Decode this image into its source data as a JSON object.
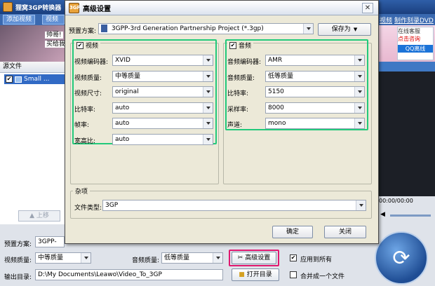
{
  "main": {
    "title": "狸窝3GP转换器",
    "menu": {
      "add_video": "添加视频",
      "video_edit": "视频编",
      "link_video": "视频",
      "link_dvd": "制作刻录DVD"
    },
    "banner": {
      "text1": "帅哥!",
      "text2": "买给我"
    },
    "ads": {
      "line1": "在线客服",
      "line2": "点击咨询",
      "line3": "QQ离线"
    },
    "file_list_header": "源文件",
    "file_item": "Small ...",
    "up_button": "上移",
    "time_display": "00:00/00:00",
    "bottom": {
      "preset_label": "预置方案:",
      "preset_value": "3GPP-",
      "video_quality_label": "视频质量:",
      "video_quality_value": "中等质量",
      "audio_quality_label": "音频质量:",
      "audio_quality_value": "低等质量",
      "advanced_button": "高级设置",
      "apply_all": "应用到所有",
      "apply_all_checked": true,
      "output_label": "输出目录:",
      "output_path": "D:\\My Documents\\Leawo\\Video_To_3GP",
      "open_dir_button": "打开目录",
      "merge_label": "合并成一个文件",
      "merge_checked": false
    }
  },
  "dialog": {
    "title": "高级设置",
    "icon_text": "3GP",
    "preset_label": "预置方案:",
    "preset_value": "3GPP-3rd Generation Partnership Project (*.3gp)",
    "save_as": "保存为",
    "video": {
      "legend": "视频",
      "enabled": true,
      "rows": [
        {
          "label": "视频编码器:",
          "value": "XVID"
        },
        {
          "label": "视频质量:",
          "value": "中等质量"
        },
        {
          "label": "视频尺寸:",
          "value": "original"
        },
        {
          "label": "比特率:",
          "value": "auto"
        },
        {
          "label": "帧率:",
          "value": "auto"
        },
        {
          "label": "宽高比:",
          "value": "auto"
        }
      ]
    },
    "audio": {
      "legend": "音频",
      "enabled": true,
      "rows": [
        {
          "label": "音频编码器:",
          "value": "AMR"
        },
        {
          "label": "音频质量:",
          "value": "低等质量"
        },
        {
          "label": "比特率:",
          "value": "5150"
        },
        {
          "label": "采样率:",
          "value": "8000"
        },
        {
          "label": "声道:",
          "value": "mono"
        }
      ]
    },
    "misc": {
      "legend": "杂项",
      "file_type_label": "文件类型:",
      "file_type_value": "3GP"
    },
    "ok": "确定",
    "close": "关闭"
  },
  "colors": {
    "highlight_green": "#22c97b",
    "highlight_pink": "#e0176f",
    "title_blue": "#2f5fa8"
  }
}
